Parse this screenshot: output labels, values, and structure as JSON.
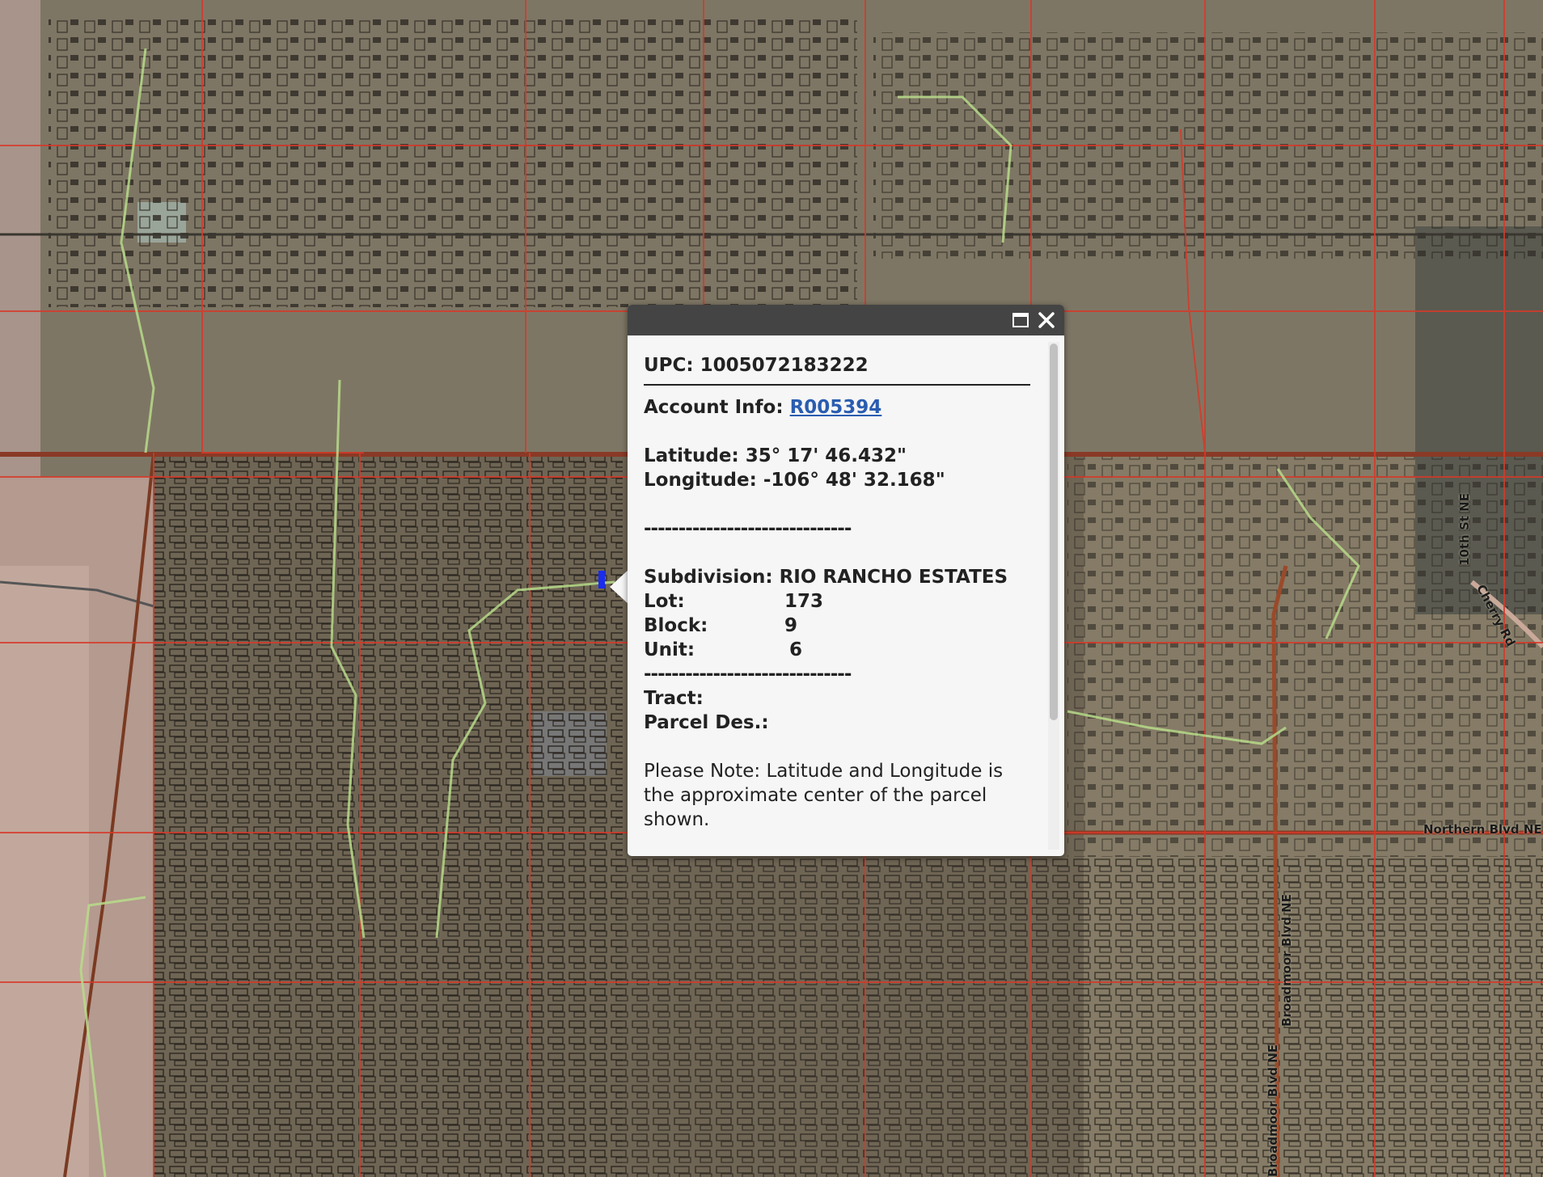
{
  "map": {
    "street_labels": [
      "10th St NE",
      "Cherry Rd",
      "Northern Blvd NE",
      "Broadmoor Blvd NE",
      "Broadmoor Blvd NE"
    ]
  },
  "popup": {
    "upc_label": "UPC:",
    "upc_value": "1005072183222",
    "account_label": "Account Info:",
    "account_value": "R005394",
    "latitude": "Latitude: 35° 17' 46.432\"",
    "longitude": "Longitude: -106° 48' 32.168\"",
    "divider": "------------------------------",
    "subdivision_label": "Subdivision:",
    "subdivision_value": "RIO RANCHO ESTATES",
    "lot_label": "Lot:",
    "lot_value": "173",
    "block_label": "Block:",
    "block_value": "9",
    "unit_label": "Unit:",
    "unit_value": "6",
    "tract_label": "Tract:",
    "parcel_des_label": "Parcel Des.:",
    "note": "Please Note: Latitude and Longitude is the approximate center of the parcel shown."
  }
}
